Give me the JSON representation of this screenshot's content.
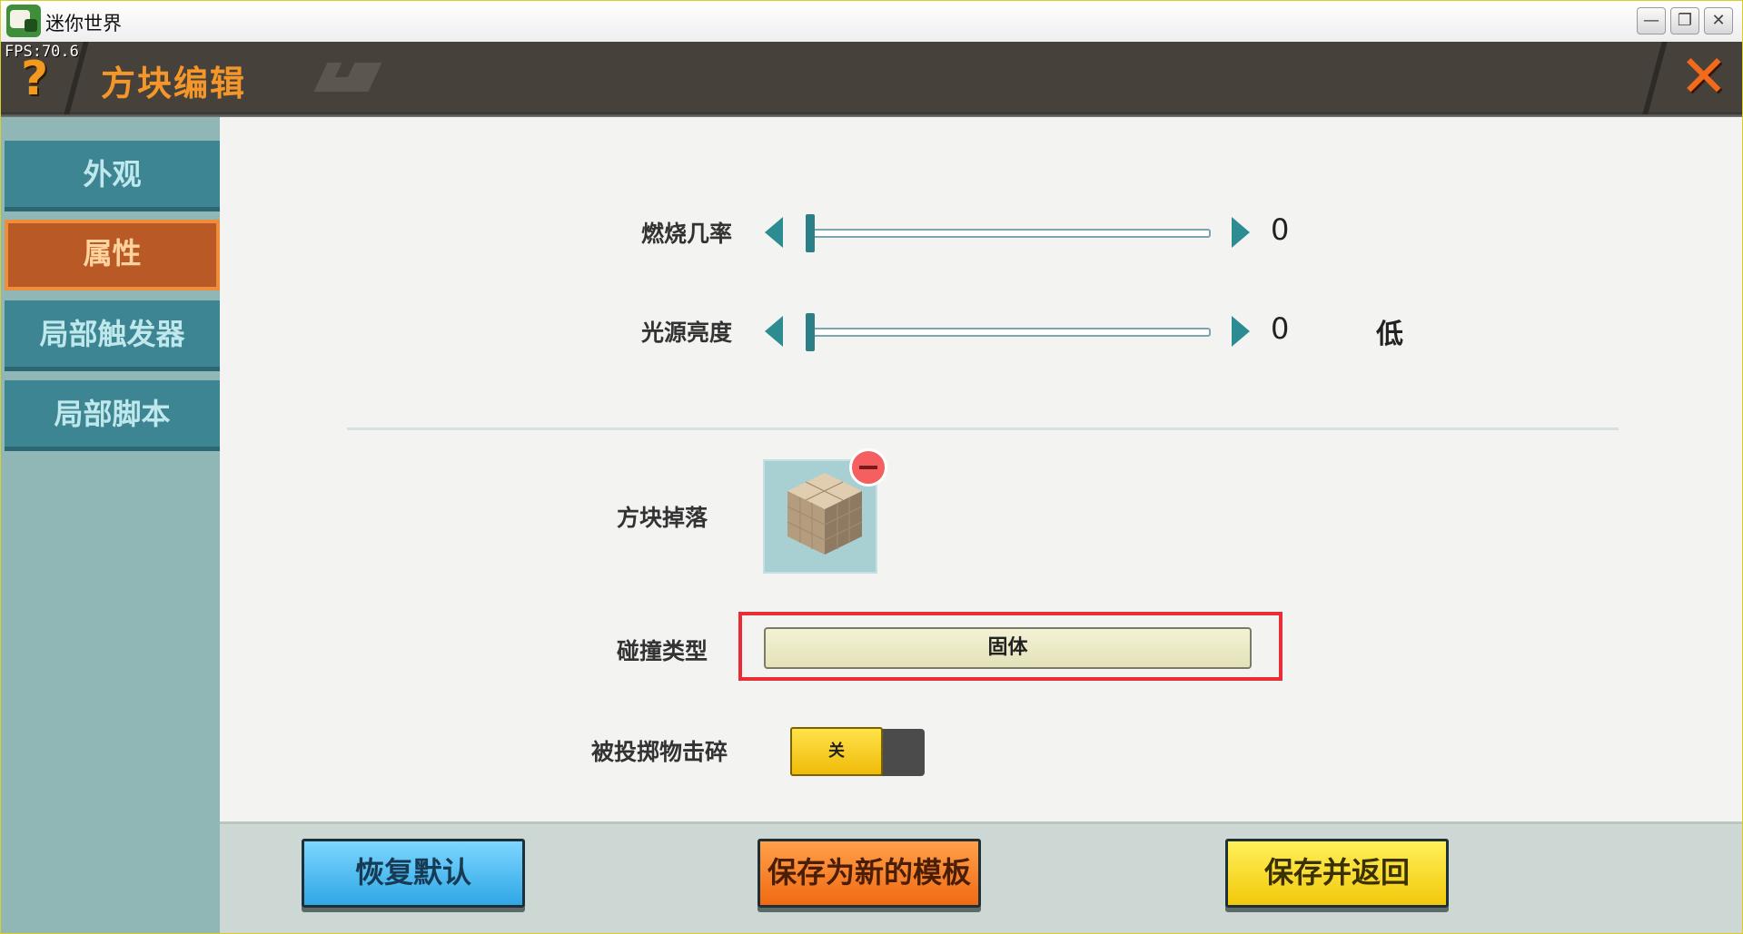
{
  "window": {
    "title": "迷你世界",
    "minimize": "—",
    "restore": "❐",
    "close": "✕"
  },
  "hud": {
    "fps": "FPS:70.6"
  },
  "header": {
    "help": "?",
    "title": "方块编辑",
    "close": "✕"
  },
  "sidebar": {
    "items": [
      {
        "label": "外观",
        "active": false
      },
      {
        "label": "属性",
        "active": true
      },
      {
        "label": "局部触发器",
        "active": false
      },
      {
        "label": "局部脚本",
        "active": false
      }
    ]
  },
  "properties": {
    "burn_rate": {
      "label": "燃烧几率",
      "value": "0",
      "fraction": 0.0
    },
    "light_level": {
      "label": "光源亮度",
      "value": "0",
      "fraction": 0.0,
      "note": "低"
    },
    "block_drop": {
      "label": "方块掉落"
    },
    "collision": {
      "label": "碰撞类型",
      "value": "固体"
    },
    "projectile_break": {
      "label": "被投掷物击碎",
      "toggle": "关"
    }
  },
  "buttons": {
    "reset": "恢复默认",
    "save_template": "保存为新的模板",
    "save_return": "保存并返回"
  },
  "colors": {
    "accent_orange": "#f5962a",
    "teal": "#3d8592",
    "highlight_red": "#ea2c36"
  }
}
